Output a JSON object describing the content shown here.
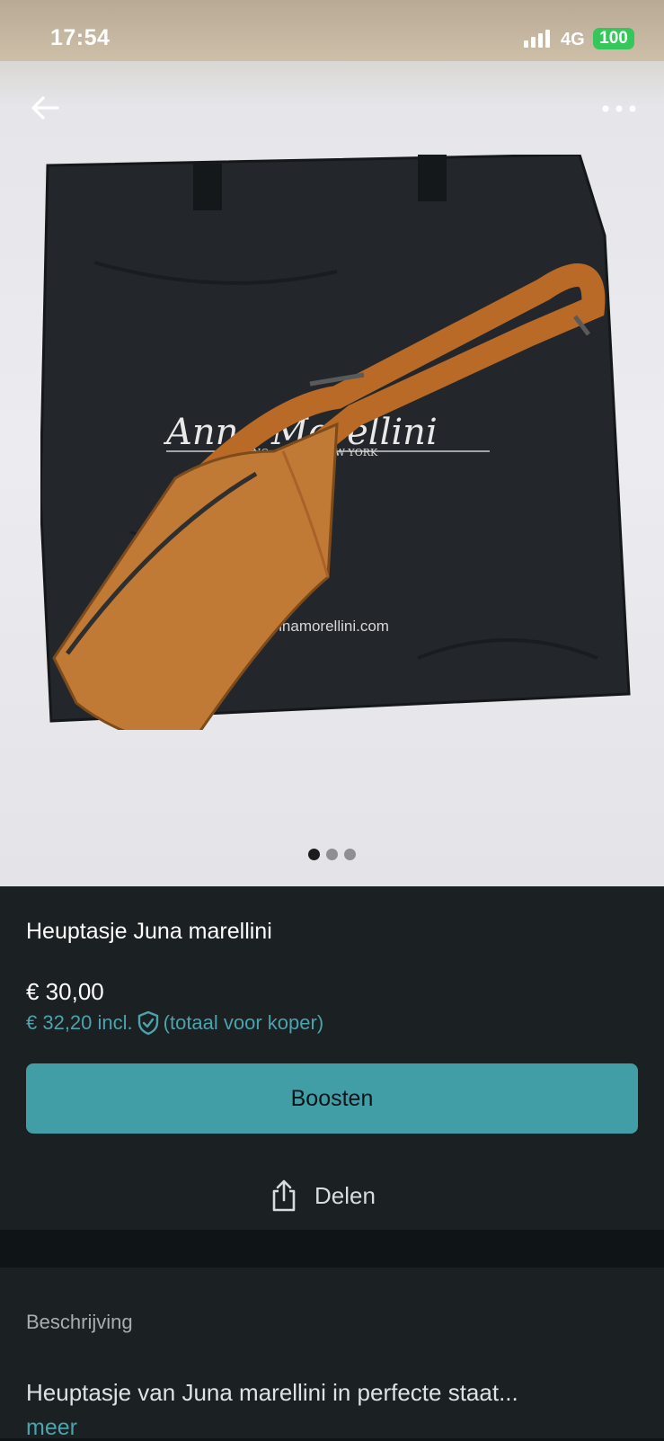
{
  "status_bar": {
    "time": "17:54",
    "network": "4G",
    "battery": "100"
  },
  "photo": {
    "bag_brand_text": "Anna Morellini",
    "bag_cities_text": "MILANO · PARIS · NEW YORK",
    "bag_url_text": "annamorellini.com",
    "carousel": {
      "total": 3,
      "active": 1
    }
  },
  "listing": {
    "title": "Heuptasje Juna marellini",
    "price": "€ 30,00",
    "price_incl": "€ 32,20 incl.",
    "price_incl_note": "(totaal voor koper)",
    "boost_label": "Boosten",
    "share_label": "Delen"
  },
  "description": {
    "label": "Beschrijving",
    "text": "Heuptasje van Juna marellini in perfecte staat...",
    "more_label": "meer"
  },
  "colors": {
    "accent": "#419ea7",
    "link": "#4aa3ad",
    "panel": "#1b2022",
    "background": "#0f1416"
  }
}
